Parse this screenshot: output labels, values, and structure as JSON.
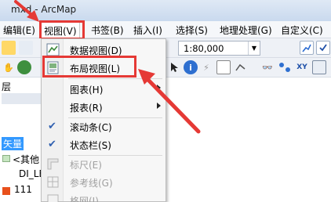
{
  "window": {
    "title": "mxd - ArcMap"
  },
  "menubar": {
    "items": [
      {
        "label": "编辑(E)"
      },
      {
        "label": "视图(V)"
      },
      {
        "label": "书签(B)"
      },
      {
        "label": "插入(I)"
      },
      {
        "label": "选择(S)"
      },
      {
        "label": "地理处理(G)"
      },
      {
        "label": "自定义(C)"
      }
    ]
  },
  "toolbar": {
    "scale_value": "1:80,000"
  },
  "toc": {
    "header": "层",
    "selected_layer": "矢量",
    "other_label": "<其他",
    "item1": "DI_LE",
    "item2": "111"
  },
  "view_menu": {
    "items": [
      {
        "label": "数据视图(D)",
        "icon": "data-view-icon"
      },
      {
        "label": "布局视图(L)",
        "icon": "layout-view-icon"
      },
      {
        "label": "图表(H)",
        "submenu": true
      },
      {
        "label": "报表(R)",
        "submenu": true
      },
      {
        "label": "滚动条(C)",
        "checked": true
      },
      {
        "label": "状态栏(S)",
        "checked": true
      },
      {
        "label": "标尺(E)",
        "disabled": true
      },
      {
        "label": "参考线(G)",
        "disabled": true
      },
      {
        "label": "格网(I)",
        "disabled": true
      }
    ]
  },
  "colors": {
    "highlight_red": "#e53935",
    "selection_blue": "#3399ff"
  }
}
